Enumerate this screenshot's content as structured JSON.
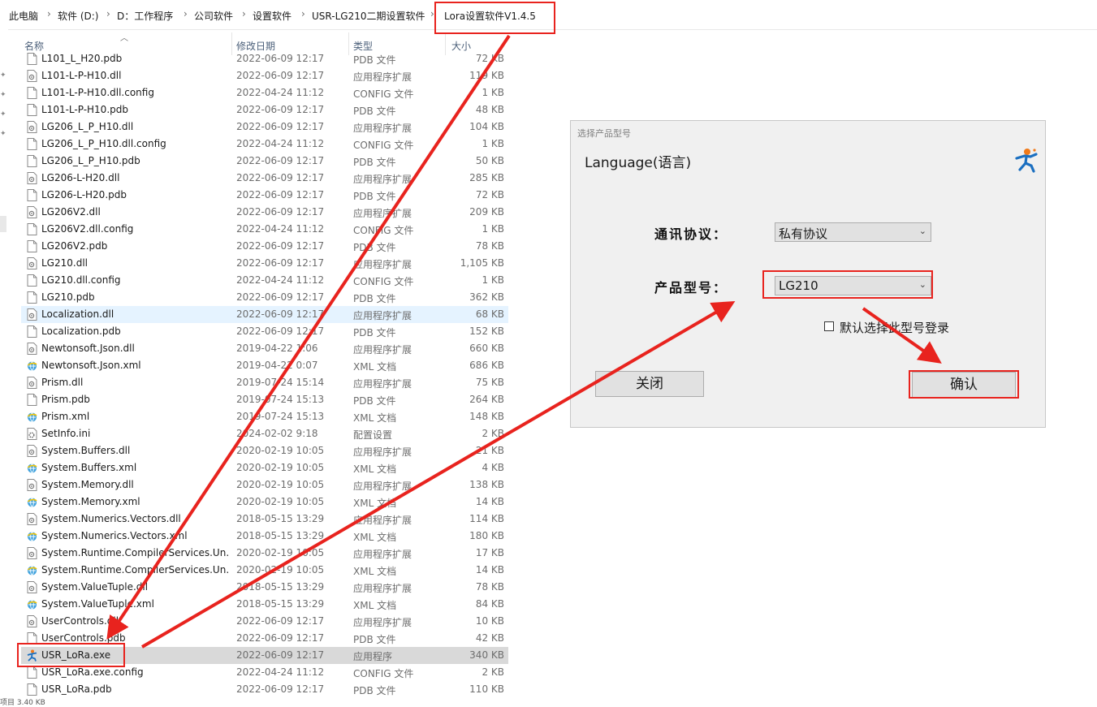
{
  "breadcrumb": [
    {
      "label": "此电脑"
    },
    {
      "label": "软件 (D:)"
    },
    {
      "label": "D：工作程序"
    },
    {
      "label": "公司软件"
    },
    {
      "label": "设置软件"
    },
    {
      "label": "USR-LG210二期设置软件"
    },
    {
      "label": "Lora设置软件V1.4.5"
    }
  ],
  "columns": {
    "name": "名称",
    "date": "修改日期",
    "type": "类型",
    "size": "大小"
  },
  "files": [
    {
      "name": "L101_L_H20.pdb",
      "date": "2022-06-09 12:17",
      "type": "PDB 文件",
      "size": "72 KB",
      "icon": "file-icon"
    },
    {
      "name": "L101-L-P-H10.dll",
      "date": "2022-06-09 12:17",
      "type": "应用程序扩展",
      "size": "119 KB",
      "icon": "dll-icon"
    },
    {
      "name": "L101-L-P-H10.dll.config",
      "date": "2022-04-24 11:12",
      "type": "CONFIG 文件",
      "size": "1 KB",
      "icon": "file-icon"
    },
    {
      "name": "L101-L-P-H10.pdb",
      "date": "2022-06-09 12:17",
      "type": "PDB 文件",
      "size": "48 KB",
      "icon": "file-icon"
    },
    {
      "name": "LG206_L_P_H10.dll",
      "date": "2022-06-09 12:17",
      "type": "应用程序扩展",
      "size": "104 KB",
      "icon": "dll-icon"
    },
    {
      "name": "LG206_L_P_H10.dll.config",
      "date": "2022-04-24 11:12",
      "type": "CONFIG 文件",
      "size": "1 KB",
      "icon": "file-icon"
    },
    {
      "name": "LG206_L_P_H10.pdb",
      "date": "2022-06-09 12:17",
      "type": "PDB 文件",
      "size": "50 KB",
      "icon": "file-icon"
    },
    {
      "name": "LG206-L-H20.dll",
      "date": "2022-06-09 12:17",
      "type": "应用程序扩展",
      "size": "285 KB",
      "icon": "dll-icon"
    },
    {
      "name": "LG206-L-H20.pdb",
      "date": "2022-06-09 12:17",
      "type": "PDB 文件",
      "size": "72 KB",
      "icon": "file-icon"
    },
    {
      "name": "LG206V2.dll",
      "date": "2022-06-09 12:17",
      "type": "应用程序扩展",
      "size": "209 KB",
      "icon": "dll-icon"
    },
    {
      "name": "LG206V2.dll.config",
      "date": "2022-04-24 11:12",
      "type": "CONFIG 文件",
      "size": "1 KB",
      "icon": "file-icon"
    },
    {
      "name": "LG206V2.pdb",
      "date": "2022-06-09 12:17",
      "type": "PDB 文件",
      "size": "78 KB",
      "icon": "file-icon"
    },
    {
      "name": "LG210.dll",
      "date": "2022-06-09 12:17",
      "type": "应用程序扩展",
      "size": "1,105 KB",
      "icon": "dll-icon"
    },
    {
      "name": "LG210.dll.config",
      "date": "2022-04-24 11:12",
      "type": "CONFIG 文件",
      "size": "1 KB",
      "icon": "file-icon"
    },
    {
      "name": "LG210.pdb",
      "date": "2022-06-09 12:17",
      "type": "PDB 文件",
      "size": "362 KB",
      "icon": "file-icon"
    },
    {
      "name": "Localization.dll",
      "date": "2022-06-09 12:17",
      "type": "应用程序扩展",
      "size": "68 KB",
      "icon": "dll-icon"
    },
    {
      "name": "Localization.pdb",
      "date": "2022-06-09 12:17",
      "type": "PDB 文件",
      "size": "152 KB",
      "icon": "file-icon"
    },
    {
      "name": "Newtonsoft.Json.dll",
      "date": "2019-04-22 1:06",
      "type": "应用程序扩展",
      "size": "660 KB",
      "icon": "dll-icon"
    },
    {
      "name": "Newtonsoft.Json.xml",
      "date": "2019-04-22 0:07",
      "type": "XML 文档",
      "size": "686 KB",
      "icon": "xml-icon"
    },
    {
      "name": "Prism.dll",
      "date": "2019-07-24 15:14",
      "type": "应用程序扩展",
      "size": "75 KB",
      "icon": "dll-icon"
    },
    {
      "name": "Prism.pdb",
      "date": "2019-07-24 15:13",
      "type": "PDB 文件",
      "size": "264 KB",
      "icon": "file-icon"
    },
    {
      "name": "Prism.xml",
      "date": "2019-07-24 15:13",
      "type": "XML 文档",
      "size": "148 KB",
      "icon": "xml-icon"
    },
    {
      "name": "SetInfo.ini",
      "date": "2024-02-02 9:18",
      "type": "配置设置",
      "size": "2 KB",
      "icon": "ini-icon"
    },
    {
      "name": "System.Buffers.dll",
      "date": "2020-02-19 10:05",
      "type": "应用程序扩展",
      "size": "21 KB",
      "icon": "dll-icon"
    },
    {
      "name": "System.Buffers.xml",
      "date": "2020-02-19 10:05",
      "type": "XML 文档",
      "size": "4 KB",
      "icon": "xml-icon"
    },
    {
      "name": "System.Memory.dll",
      "date": "2020-02-19 10:05",
      "type": "应用程序扩展",
      "size": "138 KB",
      "icon": "dll-icon"
    },
    {
      "name": "System.Memory.xml",
      "date": "2020-02-19 10:05",
      "type": "XML 文档",
      "size": "14 KB",
      "icon": "xml-icon"
    },
    {
      "name": "System.Numerics.Vectors.dll",
      "date": "2018-05-15 13:29",
      "type": "应用程序扩展",
      "size": "114 KB",
      "icon": "dll-icon"
    },
    {
      "name": "System.Numerics.Vectors.xml",
      "date": "2018-05-15 13:29",
      "type": "XML 文档",
      "size": "180 KB",
      "icon": "xml-icon"
    },
    {
      "name": "System.Runtime.CompilerServices.Un...",
      "date": "2020-02-19 10:05",
      "type": "应用程序扩展",
      "size": "17 KB",
      "icon": "dll-icon"
    },
    {
      "name": "System.Runtime.CompilerServices.Un...",
      "date": "2020-02-19 10:05",
      "type": "XML 文档",
      "size": "14 KB",
      "icon": "xml-icon"
    },
    {
      "name": "System.ValueTuple.dll",
      "date": "2018-05-15 13:29",
      "type": "应用程序扩展",
      "size": "78 KB",
      "icon": "dll-icon"
    },
    {
      "name": "System.ValueTuple.xml",
      "date": "2018-05-15 13:29",
      "type": "XML 文档",
      "size": "84 KB",
      "icon": "xml-icon"
    },
    {
      "name": "UserControls.dll",
      "date": "2022-06-09 12:17",
      "type": "应用程序扩展",
      "size": "10 KB",
      "icon": "dll-icon"
    },
    {
      "name": "UserControls.pdb",
      "date": "2022-06-09 12:17",
      "type": "PDB 文件",
      "size": "42 KB",
      "icon": "file-icon"
    },
    {
      "name": "USR_LoRa.exe",
      "date": "2022-06-09 12:17",
      "type": "应用程序",
      "size": "340 KB",
      "icon": "usr-exe-icon"
    },
    {
      "name": "USR_LoRa.exe.config",
      "date": "2022-04-24 11:12",
      "type": "CONFIG 文件",
      "size": "2 KB",
      "icon": "file-icon"
    },
    {
      "name": "USR_LoRa.pdb",
      "date": "2022-06-09 12:17",
      "type": "PDB 文件",
      "size": "110 KB",
      "icon": "file-icon"
    }
  ],
  "hover_row": 15,
  "selected_row": 35,
  "dialog": {
    "title": "选择产品型号",
    "language_label": "Language(语言)",
    "protocol_label": "通讯协议：",
    "protocol_value": "私有协议",
    "model_label": "产品型号：",
    "model_value": "LG210",
    "default_checkbox_label": "默认选择此型号登录",
    "default_checked": false,
    "close_button": "关闭",
    "confirm_button": "确认"
  },
  "annotation_color": "#e8231e",
  "status_text": "项目 3.40 KB"
}
